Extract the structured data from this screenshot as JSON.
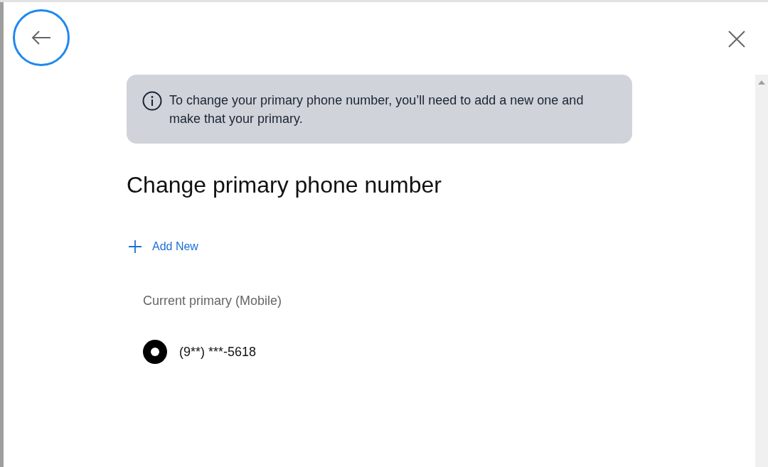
{
  "notice": {
    "text": "To change your primary phone number, you’ll need to add a new one and make that your primary."
  },
  "title": "Change primary phone number",
  "add_new": {
    "label": "Add New"
  },
  "section_label": "Current primary (Mobile)",
  "phones": [
    {
      "number": "(9**) ***-5618",
      "selected": true
    }
  ]
}
